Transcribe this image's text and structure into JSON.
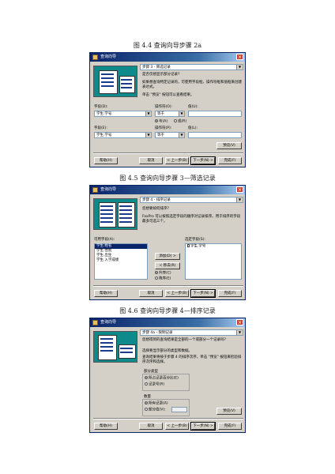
{
  "captions": {
    "fig44": "图 4.4  查询向导步骤 2a",
    "fig45": "图 4.5  查询向导步骤 3—筛选记录",
    "fig46": "图 4.6  查询向导步骤 4—排序记录"
  },
  "dialog1": {
    "title": "查询向导",
    "step": "步骤 3 - 筛选记录",
    "question": "是否仅想显示部分记录?",
    "desc": "如果想查询特定记录的，可使用字段框，操作符框和值框来创建表达式。",
    "preview_hint": "单击 \"预览\" 按钮可以查看结果。",
    "row1": {
      "field_label": "字段(D):",
      "op_label": "操作符(O):",
      "val_label": "值(U):",
      "field": "学生.学号",
      "op": "等于",
      "value": ""
    },
    "logic": {
      "and": "与(A)",
      "or": "或(R)",
      "selected": "and"
    },
    "row2": {
      "field_label": "字段(E):",
      "op_label": "操作符(P):",
      "val_label": "值(L):",
      "field": "学生.学号",
      "op": "等于",
      "value": ""
    },
    "buttons": {
      "preview": "预览(V)",
      "help": "帮助(H)",
      "cancel": "取消",
      "back": "< 上一步(B)",
      "next": "下一步(N) >",
      "finish": "完成(F)"
    }
  },
  "dialog2": {
    "title": "查询向导",
    "step": "步骤 4 - 排序记录",
    "question": "您想要如何排序?",
    "desc": "FoxPro 可以按照选定字段的顺序对记录排序。用于排序的字段最多可选三个。",
    "available_label": "可用字段(A):",
    "available": [
      "学生.姓名",
      "学生.性别",
      "学生.出生",
      "学生.入学成绩"
    ],
    "selected_label": "选定字段(S):",
    "selected": [
      "学生.学号"
    ],
    "add": "添加(D) >",
    "remove": "< 移去(R)",
    "ascending": "升序(C)",
    "descending": "降序(E)",
    "buttons": {
      "help": "帮助(H)",
      "cancel": "取消",
      "back": "< 上一步(B)",
      "next": "下一步(N) >",
      "finish": "完成(F)"
    }
  },
  "dialog3": {
    "title": "查询向导",
    "step": "步骤 4a - 限制记录",
    "question": "您想得到的查询结果是全部的一个或部分一个记录吗?",
    "desc1": "选择要显示部分的类型和数据。",
    "desc2": "查询结果将按于步骤 4 的排序次序，单击 \"预览\" 按钮来检验排序次序和选择。",
    "portion_group": "部分类型",
    "portion_percent": "所占记录百分比(E)",
    "portion_count": "记录号(R)",
    "amount_group": "数量",
    "amount_all": "所有记录(A)",
    "amount_part": "部分值(V):",
    "amount_value": "",
    "buttons": {
      "preview": "预览(V)",
      "help": "帮助(H)",
      "cancel": "取消",
      "back": "< 上一步(B)",
      "next": "下一步(N) >",
      "finish": "完成(F)"
    }
  }
}
